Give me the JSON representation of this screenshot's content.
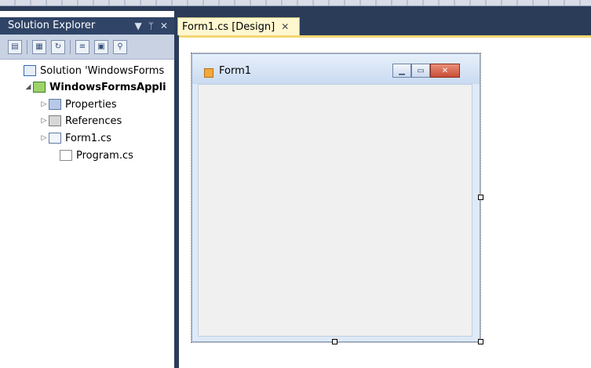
{
  "solution_explorer": {
    "title": "Solution Explorer",
    "controls": {
      "dropdown": "▼",
      "pin": "ᛘ",
      "close": "✕"
    },
    "toolbar_icons": [
      "properties-icon",
      "show-all-files-icon",
      "refresh-icon",
      "view-code-icon",
      "view-designer-icon",
      "class-diagram-icon"
    ],
    "tree": {
      "solution": "Solution 'WindowsForms",
      "project": "WindowsFormsAppli",
      "items": [
        "Properties",
        "References",
        "Form1.cs",
        "Program.cs"
      ]
    }
  },
  "document_tab": {
    "label": "Form1.cs [Design]",
    "close": "✕"
  },
  "form": {
    "title": "Form1"
  },
  "colors": {
    "ide_background": "#2b3c59",
    "panel_title": "#304467",
    "tab_background": "#fff7cf",
    "tab_accent": "#f3d672",
    "form_client": "#f0f0f0"
  }
}
